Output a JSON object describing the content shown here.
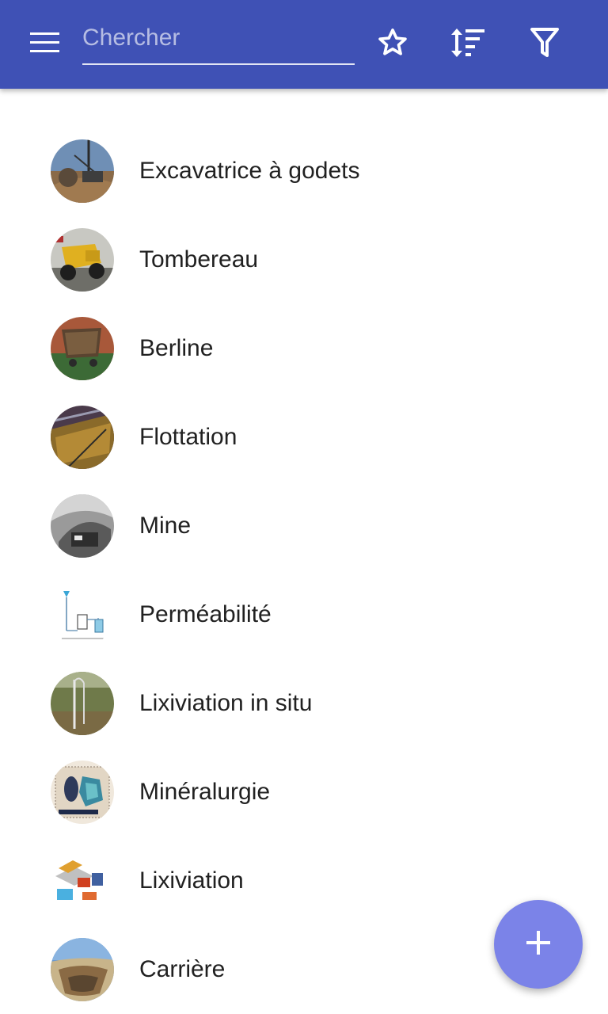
{
  "appbar": {
    "background": "#3f51b5",
    "menu_icon": "hamburger-menu-icon",
    "search": {
      "placeholder": "Chercher",
      "value": ""
    },
    "actions": [
      {
        "name": "favorites",
        "icon": "star-outline-icon"
      },
      {
        "name": "sort",
        "icon": "sort-icon"
      },
      {
        "name": "filter",
        "icon": "filter-icon"
      }
    ]
  },
  "items": [
    {
      "label": "Excavatrice à godets",
      "thumbnail": "bucket-wheel-excavator-photo"
    },
    {
      "label": "Tombereau",
      "thumbnail": "dump-truck-photo"
    },
    {
      "label": "Berline",
      "thumbnail": "mine-cart-photo"
    },
    {
      "label": "Flottation",
      "thumbnail": "flotation-photo"
    },
    {
      "label": "Mine",
      "thumbnail": "mine-tunnel-photo"
    },
    {
      "label": "Perméabilité",
      "thumbnail": "permeability-diagram"
    },
    {
      "label": "Lixiviation in situ",
      "thumbnail": "in-situ-leaching-photo"
    },
    {
      "label": "Minéralurgie",
      "thumbnail": "mineral-stamp-image"
    },
    {
      "label": "Lixiviation",
      "thumbnail": "leaching-diagram"
    },
    {
      "label": "Carrière",
      "thumbnail": "quarry-photo"
    }
  ],
  "fab": {
    "icon": "plus-icon",
    "color": "#7b83e8"
  }
}
